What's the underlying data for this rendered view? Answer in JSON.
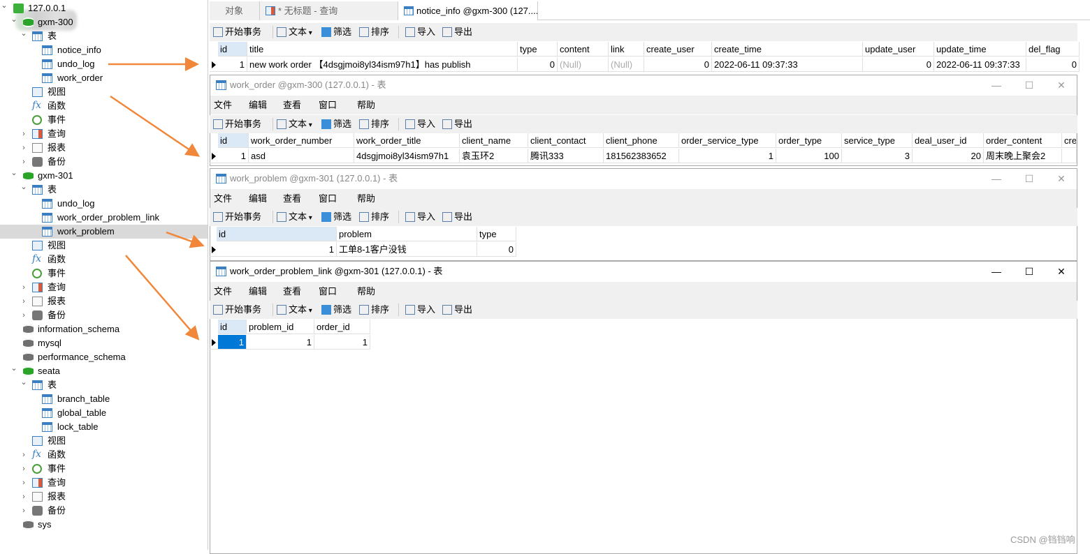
{
  "sidebar": {
    "items": [
      {
        "label": "127.0.0.1",
        "icon": "server-icon",
        "level": 0,
        "arrow": "open"
      },
      {
        "label": "gxm-300",
        "icon": "database-icon",
        "level": 1,
        "arrow": "open"
      },
      {
        "label": "表",
        "icon": "table-folder-icon",
        "level": 2,
        "arrow": "open"
      },
      {
        "label": "notice_info",
        "icon": "table-icon",
        "level": 3
      },
      {
        "label": "undo_log",
        "icon": "table-icon",
        "level": 3
      },
      {
        "label": "work_order",
        "icon": "table-icon",
        "level": 3
      },
      {
        "label": "视图",
        "icon": "view-icon",
        "level": 2
      },
      {
        "label": "函数",
        "icon": "function-icon",
        "level": 2
      },
      {
        "label": "事件",
        "icon": "event-icon",
        "level": 2
      },
      {
        "label": "查询",
        "icon": "query-icon",
        "level": 2,
        "arrow": "closed"
      },
      {
        "label": "报表",
        "icon": "report-icon",
        "level": 2,
        "arrow": "closed"
      },
      {
        "label": "备份",
        "icon": "backup-icon",
        "level": 2,
        "arrow": "closed"
      },
      {
        "label": "gxm-301",
        "icon": "database-icon",
        "level": 1,
        "arrow": "open"
      },
      {
        "label": "表",
        "icon": "table-folder-icon",
        "level": 2,
        "arrow": "open"
      },
      {
        "label": "undo_log",
        "icon": "table-icon",
        "level": 3
      },
      {
        "label": "work_order_problem_link",
        "icon": "table-icon",
        "level": 3
      },
      {
        "label": "work_problem",
        "icon": "table-icon",
        "level": 3,
        "selected": true
      },
      {
        "label": "视图",
        "icon": "view-icon",
        "level": 2
      },
      {
        "label": "函数",
        "icon": "function-icon",
        "level": 2
      },
      {
        "label": "事件",
        "icon": "event-icon",
        "level": 2
      },
      {
        "label": "查询",
        "icon": "query-icon",
        "level": 2,
        "arrow": "closed"
      },
      {
        "label": "报表",
        "icon": "report-icon",
        "level": 2,
        "arrow": "closed"
      },
      {
        "label": "备份",
        "icon": "backup-icon",
        "level": 2,
        "arrow": "closed"
      },
      {
        "label": "information_schema",
        "icon": "database-gray-icon",
        "level": 1
      },
      {
        "label": "mysql",
        "icon": "database-gray-icon",
        "level": 1
      },
      {
        "label": "performance_schema",
        "icon": "database-gray-icon",
        "level": 1
      },
      {
        "label": "seata",
        "icon": "database-icon",
        "level": 1,
        "arrow": "open"
      },
      {
        "label": "表",
        "icon": "table-folder-icon",
        "level": 2,
        "arrow": "open"
      },
      {
        "label": "branch_table",
        "icon": "table-icon",
        "level": 3
      },
      {
        "label": "global_table",
        "icon": "table-icon",
        "level": 3
      },
      {
        "label": "lock_table",
        "icon": "table-icon",
        "level": 3
      },
      {
        "label": "视图",
        "icon": "view-icon",
        "level": 2
      },
      {
        "label": "函数",
        "icon": "function-icon",
        "level": 2,
        "arrow": "closed"
      },
      {
        "label": "事件",
        "icon": "event-icon",
        "level": 2,
        "arrow": "closed"
      },
      {
        "label": "查询",
        "icon": "query-icon",
        "level": 2,
        "arrow": "closed"
      },
      {
        "label": "报表",
        "icon": "report-icon",
        "level": 2,
        "arrow": "closed"
      },
      {
        "label": "备份",
        "icon": "backup-icon",
        "level": 2,
        "arrow": "closed"
      },
      {
        "label": "sys",
        "icon": "database-gray-icon",
        "level": 1
      }
    ]
  },
  "tabs": [
    {
      "label": "对象"
    },
    {
      "label": "* 无标题 - 查询"
    },
    {
      "label": "notice_info @gxm-300 (127...."
    }
  ],
  "toolbar": {
    "begin": "开始事务",
    "text": "文本",
    "filter": "筛选",
    "sort": "排序",
    "import": "导入",
    "export": "导出"
  },
  "menu": [
    "文件",
    "编辑",
    "查看",
    "窗口",
    "帮助"
  ],
  "grids": [
    {
      "name": "notice_info",
      "columns": [
        "id",
        "title",
        "type",
        "content",
        "link",
        "create_user",
        "create_time",
        "update_user",
        "update_time",
        "del_flag"
      ],
      "rows": [
        [
          "1",
          "new work order 【4dsgjmoi8yl34ism97h1】has publish",
          "0",
          "(Null)",
          "(Null)",
          "0",
          "2022-06-11 09:37:33",
          "0",
          "2022-06-11 09:37:33",
          "0"
        ]
      ]
    },
    {
      "name": "work_order",
      "title": "work_order @gxm-300 (127.0.0.1) - 表",
      "columns": [
        "id",
        "work_order_number",
        "work_order_title",
        "client_name",
        "client_contact",
        "client_phone",
        "order_service_type",
        "order_type",
        "service_type",
        "deal_user_id",
        "order_content",
        "cre"
      ],
      "rows": [
        [
          "1",
          "asd",
          "4dsgjmoi8yl34ism97h1",
          "袁玉环2",
          "腾讯333",
          "181562383652",
          "1",
          "100",
          "3",
          "20",
          "周末晚上聚会2",
          ""
        ]
      ]
    },
    {
      "name": "work_problem",
      "title": "work_problem @gxm-301 (127.0.0.1) - 表",
      "columns": [
        "id",
        "problem",
        "type"
      ],
      "rows": [
        [
          "1",
          "工单8-1客户没钱",
          "0"
        ]
      ]
    },
    {
      "name": "work_order_problem_link",
      "title": "work_order_problem_link @gxm-301 (127.0.0.1) - 表",
      "columns": [
        "id",
        "problem_id",
        "order_id"
      ],
      "rows": [
        [
          "1",
          "1",
          "1"
        ]
      ]
    }
  ],
  "window_buttons": {
    "minimize": "—",
    "maximize": "☐",
    "close": "✕"
  },
  "watermark": "CSDN @铛铛响",
  "colors": {
    "accent": "#0078d7",
    "arrow": "#f0873a",
    "header_selected": "#dbe9f7"
  }
}
